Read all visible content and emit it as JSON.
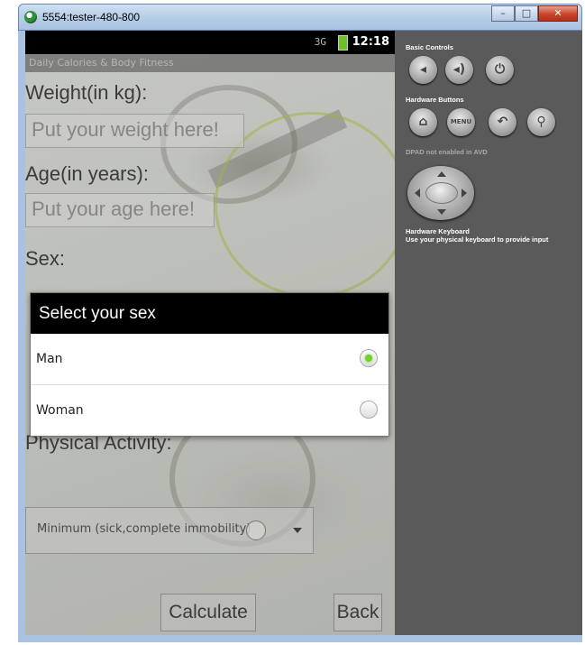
{
  "window": {
    "title": "5554:tester-480-800",
    "min_label": "–",
    "max_label": "□",
    "close_label": "✕"
  },
  "status_bar": {
    "signal_label": "3G",
    "time": "12:18"
  },
  "app": {
    "title": "Daily Calories & Body Fitness",
    "weight_label": "Weight(in kg):",
    "weight_placeholder": "Put your weight here!",
    "age_label": "Age(in years):",
    "age_placeholder": "Put your age here!",
    "sex_label": "Sex:",
    "activity_label": "Physical Activity:",
    "activity_value": "Minimum (sick,complete immobility)",
    "calculate_label": "Calculate",
    "back_label": "Back"
  },
  "dialog": {
    "title": "Select your sex",
    "options": [
      {
        "label": "Man",
        "selected": true
      },
      {
        "label": "Woman",
        "selected": false
      }
    ],
    "selected_color": "#6fd12a"
  },
  "controls": {
    "basic_controls_label": "Basic Controls",
    "hardware_buttons_label": "Hardware Buttons",
    "menu_label": "MENU",
    "dpad_note": "DPAD not enabled in AVD",
    "keyboard_title": "Hardware Keyboard",
    "keyboard_note": "Use your physical keyboard to provide input",
    "icons": [
      "volume-down-icon",
      "volume-up-icon",
      "power-icon",
      "home-icon",
      "menu-icon",
      "back-icon",
      "search-icon"
    ]
  }
}
